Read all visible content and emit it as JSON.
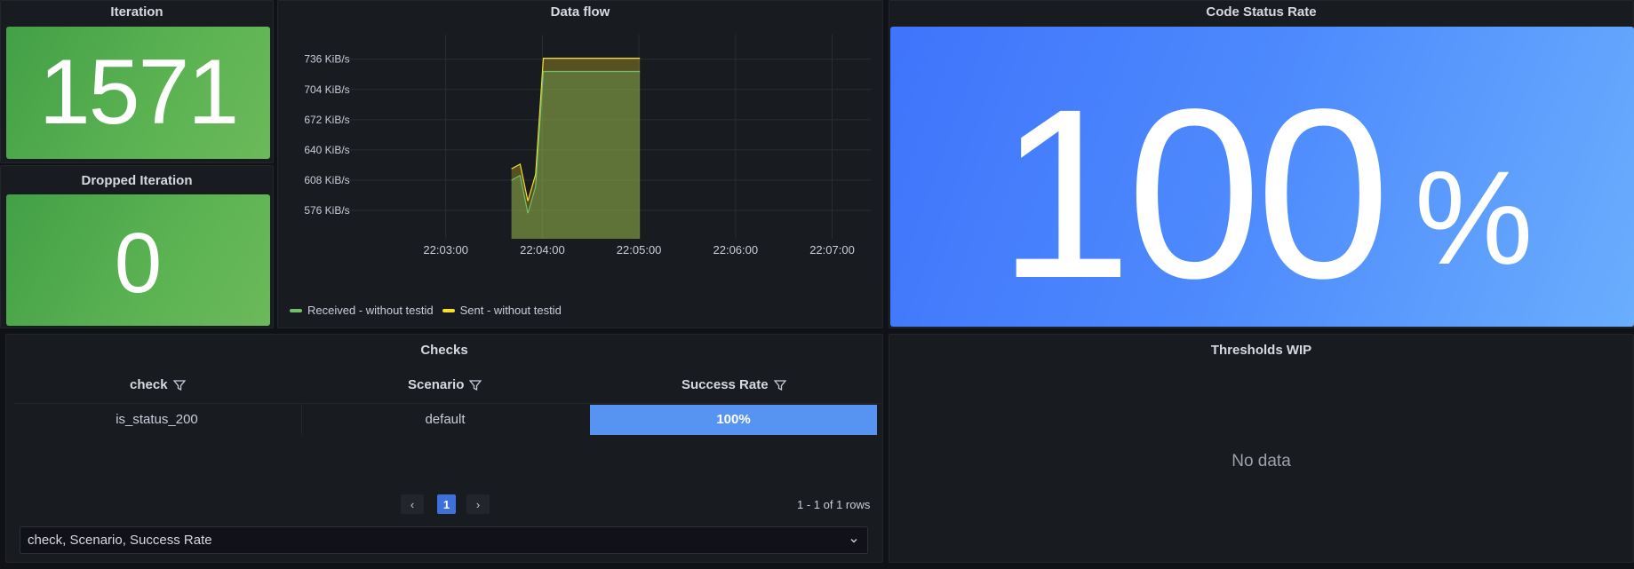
{
  "colors": {
    "background": "#111217",
    "panel": "#181b1f",
    "stat_green": "#5cb352",
    "big_blue": "#4e8bfd",
    "received_green": "#73bf69",
    "sent_yellow": "#fade2a",
    "success_bar": "#5794f2",
    "pager_active": "#3d71d9"
  },
  "iteration": {
    "title": "Iteration",
    "value": "1571"
  },
  "dropped": {
    "title": "Dropped Iteration",
    "value": "0"
  },
  "dataflow": {
    "title": "Data flow",
    "legend": [
      {
        "name": "Received - without testid",
        "color": "#73bf69"
      },
      {
        "name": "Sent - without testid",
        "color": "#fade2a"
      }
    ]
  },
  "chart_data": {
    "type": "area",
    "title": "Data flow",
    "y_tick_labels": [
      "736 KiB/s",
      "704 KiB/s",
      "672 KiB/s",
      "640 KiB/s",
      "608 KiB/s",
      "576 KiB/s"
    ],
    "y_ticks": [
      736,
      704,
      672,
      640,
      608,
      576
    ],
    "x_tick_labels": [
      "22:03:00",
      "22:04:00",
      "22:05:00",
      "22:06:00",
      "22:07:00"
    ],
    "x_ticks_minutes": [
      3,
      4,
      5,
      6,
      7
    ],
    "xlim_minutes": [
      2,
      7.4
    ],
    "ylim": [
      546,
      762
    ],
    "x_unit": "time since 22:00:00 (min)",
    "series": [
      {
        "name": "Received - without testid",
        "color": "#73bf69",
        "x_minutes": [
          3.68,
          3.77,
          3.85,
          3.93,
          4.01,
          5.01
        ],
        "values": [
          608,
          613,
          573,
          601,
          723,
          723
        ]
      },
      {
        "name": "Sent - without testid",
        "color": "#fade2a",
        "x_minutes": [
          3.68,
          3.77,
          3.85,
          3.93,
          4.01,
          5.01
        ],
        "values": [
          620,
          625,
          586,
          614,
          737,
          737
        ]
      }
    ],
    "grid": true,
    "legend_position": "bottom-left"
  },
  "code_status": {
    "title": "Code Status Rate",
    "value": "100",
    "unit": "%"
  },
  "checks": {
    "title": "Checks",
    "columns": [
      "check",
      "Scenario",
      "Success Rate"
    ],
    "rows": [
      {
        "check": "is_status_200",
        "scenario": "default",
        "success_rate": "100%",
        "success_fraction": 1.0
      }
    ],
    "pagination": {
      "prev": "‹",
      "page": "1",
      "next": "›",
      "summary": "1 - 1 of 1 rows"
    },
    "column_select": "check, Scenario, Success Rate"
  },
  "thresholds": {
    "title": "Thresholds WIP",
    "empty_text": "No data"
  }
}
